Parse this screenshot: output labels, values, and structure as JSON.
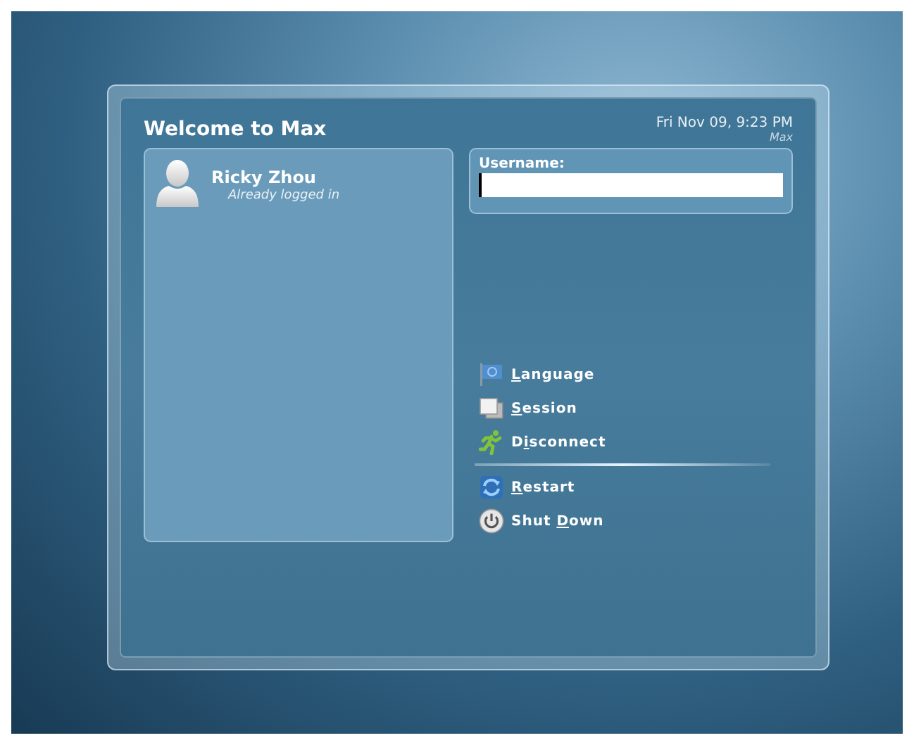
{
  "dialog": {
    "title": "Welcome to Max",
    "datetime": "Fri Nov 09,  9:23 PM",
    "hostname": "Max"
  },
  "users": [
    {
      "name": "Ricky Zhou",
      "status": "Already logged in",
      "selected": false
    }
  ],
  "login": {
    "label": "Username:"
  },
  "actions": [
    {
      "kind": "language",
      "key": "L",
      "post": "anguage"
    },
    {
      "kind": "session",
      "key": "S",
      "post": "ession"
    },
    {
      "kind": "disconnect",
      "pre": "D",
      "key": "i",
      "post": "sconnect"
    },
    {
      "kind": "separator"
    },
    {
      "kind": "restart",
      "key": "R",
      "post": "estart"
    },
    {
      "kind": "shutdown",
      "pre": "Shut ",
      "key": "D",
      "post": "own"
    }
  ]
}
